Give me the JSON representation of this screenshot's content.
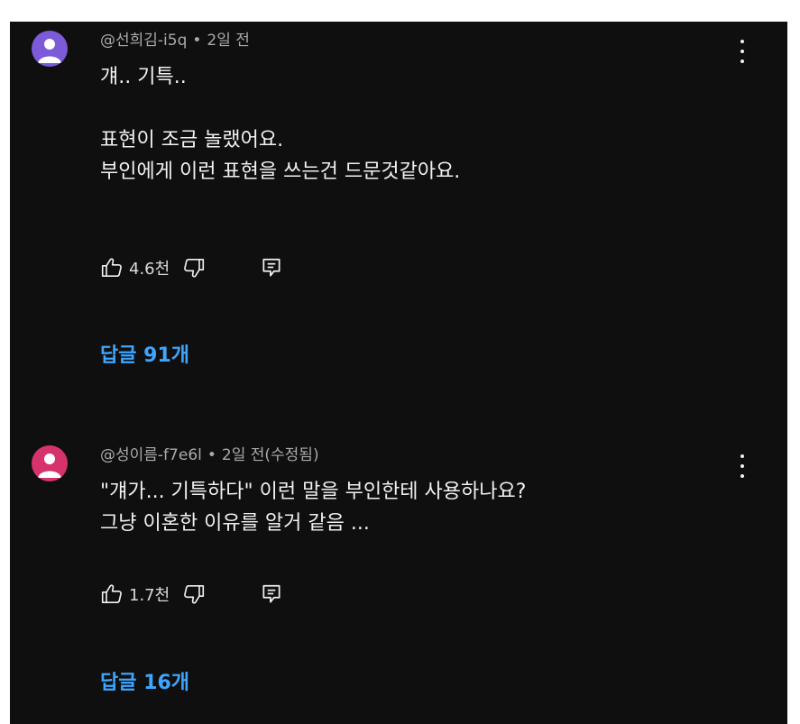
{
  "comments": [
    {
      "author": "@선희김-i5q",
      "separator": "•",
      "time": "2일 전",
      "text": "걔.. 기특..\n\n표현이 조금 놀랬어요.\n부인에게 이런 표현을 쓰는건 드문것같아요.",
      "likes": "4.6천",
      "replies_label": "답글 91개",
      "avatar_color": "#7b5bd8",
      "avatar_icon": "person-icon",
      "like_icon": "thumbs-up-icon",
      "dislike_icon": "thumbs-down-icon",
      "reply_icon": "reply-icon",
      "more_icon": "more-vert-icon"
    },
    {
      "author": "@성이름-f7e6l",
      "separator": "•",
      "time": "2일 전(수정됨)",
      "text": "\"걔가... 기특하다\" 이런 말을 부인한테 사용하나요?\n그냥 이혼한 이유를 알거 같음 ...",
      "likes": "1.7천",
      "replies_label": "답글 16개",
      "avatar_color": "#d6336c",
      "avatar_icon": "person-icon",
      "like_icon": "thumbs-up-icon",
      "dislike_icon": "thumbs-down-icon",
      "reply_icon": "reply-icon",
      "more_icon": "more-vert-icon"
    }
  ],
  "colors": {
    "background": "#0f0f0f",
    "text": "#f1f1f1",
    "meta": "#aaaaaa",
    "link": "#3ea6ff"
  }
}
